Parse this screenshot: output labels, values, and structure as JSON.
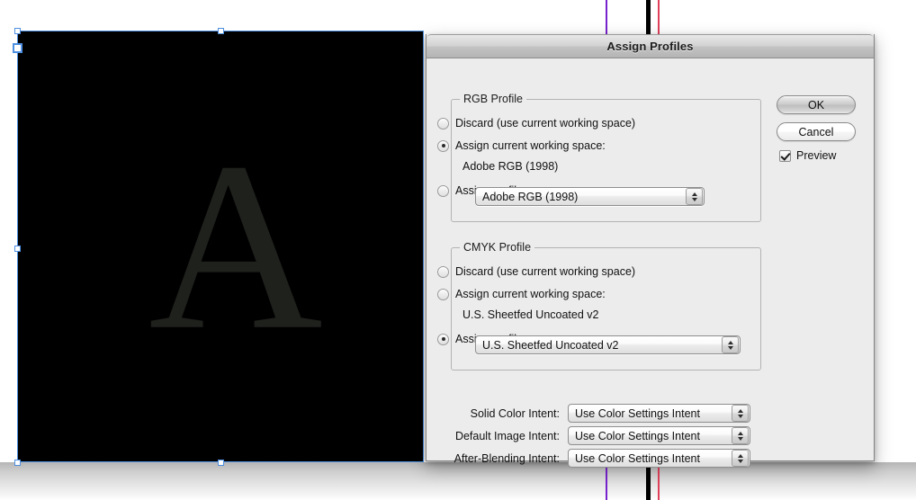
{
  "canvas": {
    "artwork_letter": "A",
    "artwork_color": "#1f211d",
    "artboard_color": "#000000",
    "selection_color": "#4d8fe0",
    "guides": [
      {
        "name": "guide-purple",
        "color": "#7722cc"
      },
      {
        "name": "guide-black",
        "color": "#000000"
      },
      {
        "name": "guide-red",
        "color": "#e0405a"
      }
    ]
  },
  "dialog": {
    "title": "Assign Profiles",
    "rgb_group": {
      "legend": "RGB Profile",
      "options": [
        {
          "label": "Discard (use current working space)",
          "selected": false
        },
        {
          "label": "Assign current working space:",
          "selected": true
        },
        {
          "label": "Assign profile:",
          "selected": false
        }
      ],
      "current_working_space": "Adobe RGB (1998)",
      "profile_popup_value": "Adobe RGB (1998)"
    },
    "cmyk_group": {
      "legend": "CMYK Profile",
      "options": [
        {
          "label": "Discard (use current working space)",
          "selected": false
        },
        {
          "label": "Assign current working space:",
          "selected": false
        },
        {
          "label": "Assign profile:",
          "selected": true
        }
      ],
      "current_working_space": "U.S. Sheetfed Uncoated v2",
      "profile_popup_value": "U.S. Sheetfed Uncoated v2"
    },
    "intents": [
      {
        "label": "Solid Color Intent:",
        "value": "Use Color Settings Intent"
      },
      {
        "label": "Default Image Intent:",
        "value": "Use Color Settings Intent"
      },
      {
        "label": "After-Blending Intent:",
        "value": "Use Color Settings Intent"
      }
    ],
    "buttons": {
      "ok": "OK",
      "cancel": "Cancel"
    },
    "preview": {
      "label": "Preview",
      "checked": true
    }
  }
}
